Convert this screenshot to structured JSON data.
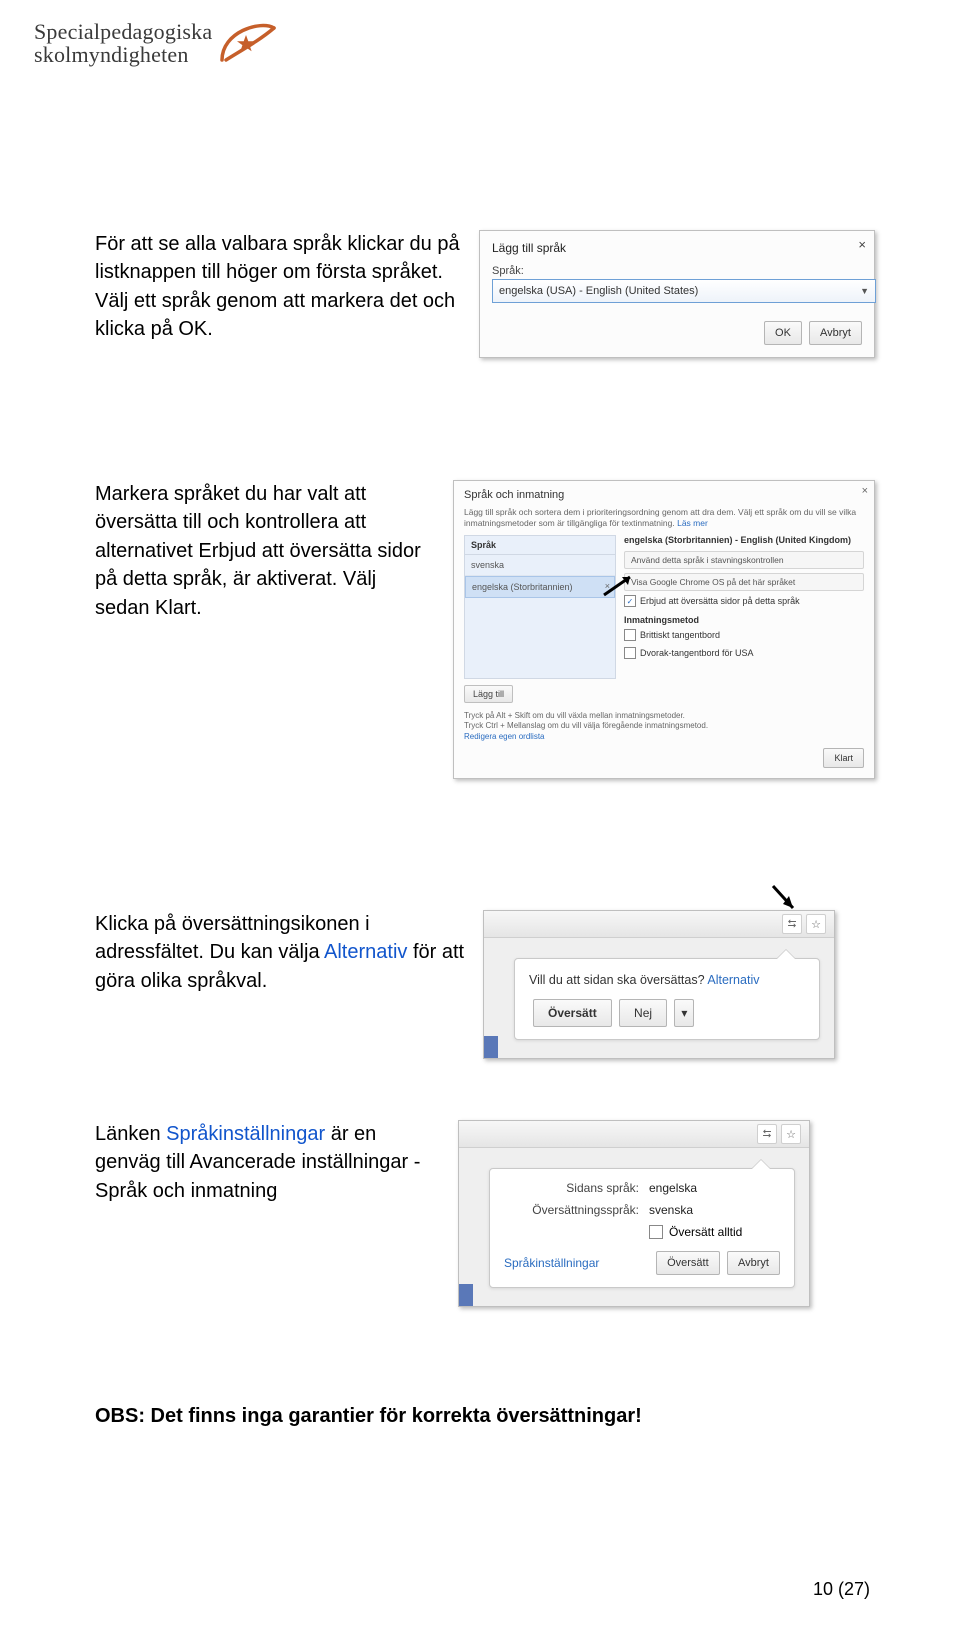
{
  "logo": {
    "line1": "Specialpedagogiska",
    "line2": "skolmyndigheten"
  },
  "sec1": {
    "text": "För att se alla valbara språk klickar du på listknappen till höger om första språket. Välj ett språk genom att markera det och klicka på OK.",
    "shot": {
      "title": "Lägg till språk",
      "lbl": "Språk:",
      "value": "engelska (USA) - English (United States)",
      "ok": "OK",
      "cancel": "Avbryt"
    }
  },
  "sec2": {
    "text": "Markera språket du har valt att översätta till och kontrollera att alternativet Erbjud att översätta sidor på detta språk, är aktiverat. Välj sedan Klart.",
    "shot": {
      "title": "Språk och inmatning",
      "desc": "Lägg till språk och sortera dem i prioriteringsordning genom att dra dem. Välj ett språk om du vill se vilka inmatningsmetoder som är tillgängliga för textinmatning.",
      "learn": "Läs mer",
      "col_sprak": "Språk",
      "lang1": "svenska",
      "lang2": "engelska (Storbritannien)",
      "right_header": "engelska (Storbritannien) - English (United Kingdom)",
      "opt1": "Använd detta språk i stavningskontrollen",
      "opt2": "Visa Google Chrome OS på det här språket",
      "opt3": "Erbjud att översätta sidor på detta språk",
      "inmatning": "Inmatningsmetod",
      "kb1": "Brittiskt tangentbord",
      "kb2": "Dvorak-tangentbord för USA",
      "add": "Lägg till",
      "hint1": "Tryck på Alt + Skift om du vill växla mellan inmatningsmetoder.",
      "hint2": "Tryck Ctrl + Mellanslag om du vill välja föregående inmatningsmetod.",
      "editlist": "Redigera egen ordlista",
      "klart": "Klart"
    }
  },
  "sec3": {
    "text1": "Klicka på översättningsikonen i adressfältet. Du kan välja ",
    "link": "Alternativ",
    "text2": " för att göra olika språkval.",
    "shot": {
      "q": "Vill du att sidan ska översättas?",
      "alt": "Alternativ",
      "translate": "Översätt",
      "no": "Nej"
    }
  },
  "sec4": {
    "text1": "Länken ",
    "link": "Språkinställningar",
    "text2": " är en genväg till Avancerade inställningar - Språk och inmatning",
    "shot": {
      "lab1": "Sidans språk:",
      "val1": "engelska",
      "lab2": "Översättningsspråk:",
      "val2": "svenska",
      "always": "Översätt alltid",
      "settings": "Språkinställningar",
      "translate": "Översätt",
      "cancel": "Avbryt"
    }
  },
  "obs": "OBS: Det finns inga garantier för korrekta översättningar!",
  "pager": "10 (27)"
}
